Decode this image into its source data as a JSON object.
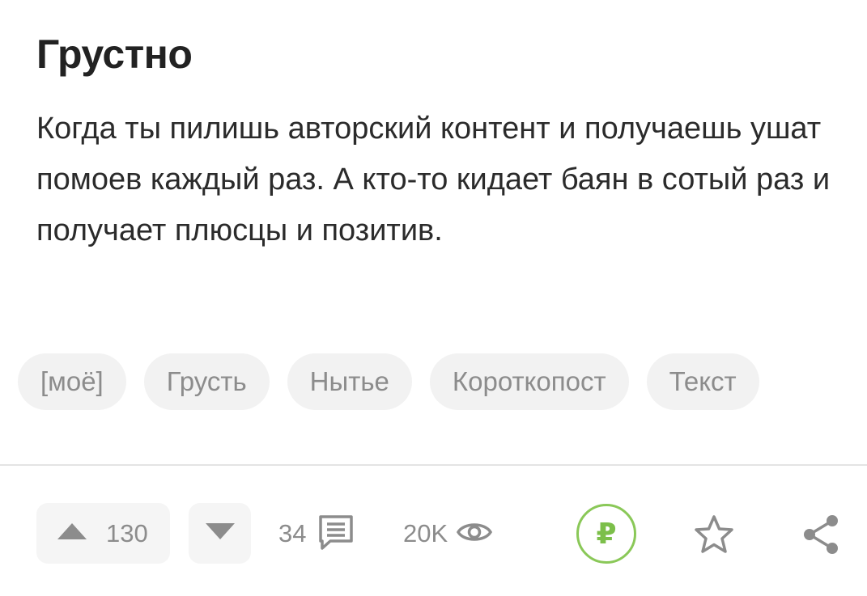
{
  "post": {
    "title": "Грустно",
    "text": "Когда ты пилишь авторский контент и получаешь ушат помоев каждый раз. А кто-то кидает баян в сотый раз и получает плюсцы и позитив."
  },
  "tags": [
    "[моё]",
    "Грусть",
    "Нытье",
    "Короткопост",
    "Текст"
  ],
  "footer": {
    "upvotes": "130",
    "comments": "34",
    "views": "20K",
    "donate_symbol": "₽"
  },
  "colors": {
    "text": "#222222",
    "tag_bg": "#f2f2f2",
    "muted": "#8c8c8c",
    "donate_green": "#7cbf4a"
  },
  "icons": [
    "upvote-icon",
    "downvote-icon",
    "comment-icon",
    "eye-icon",
    "ruble-icon",
    "star-icon",
    "share-icon"
  ]
}
